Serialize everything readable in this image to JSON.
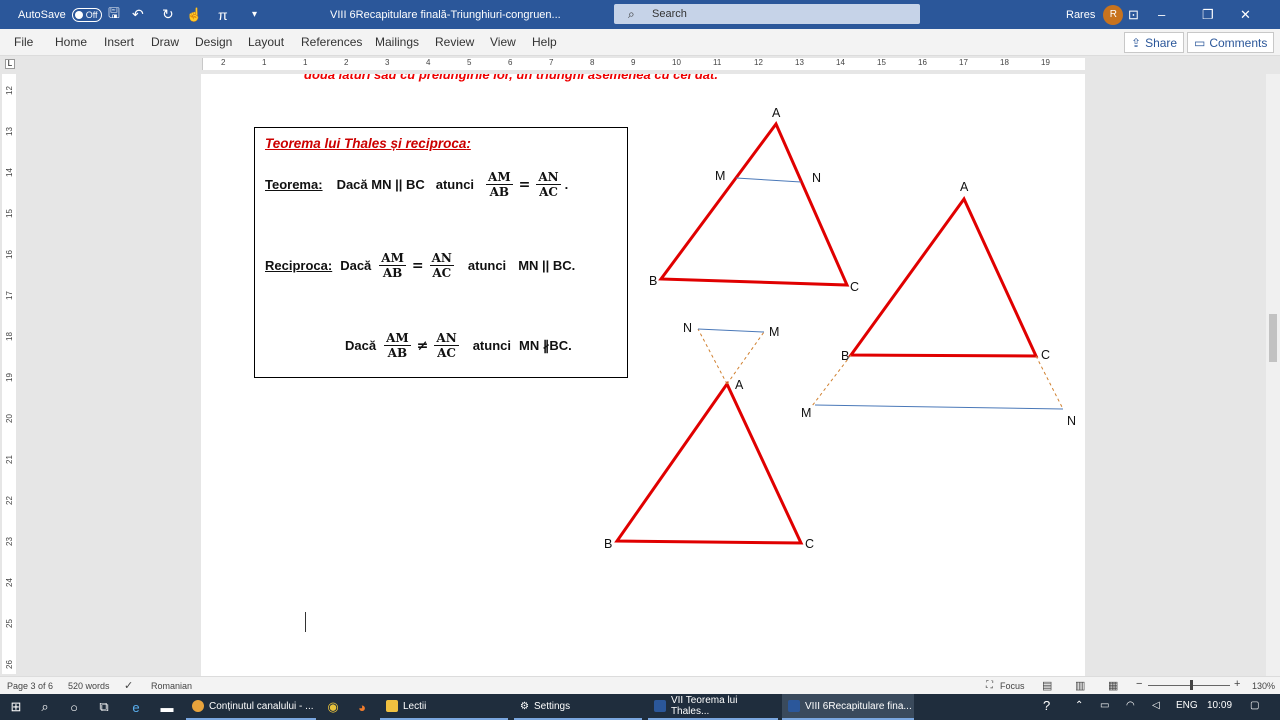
{
  "titlebar": {
    "autosave_label": "AutoSave",
    "autosave_state": "Off",
    "doc_title": "VIII 6Recapitulare finală-Triunghiuri-congruen...",
    "search_placeholder": "Search",
    "user_name": "Rares",
    "user_initial": "R"
  },
  "menu": {
    "items": [
      "File",
      "Home",
      "Insert",
      "Draw",
      "Design",
      "Layout",
      "References",
      "Mailings",
      "Review",
      "View",
      "Help"
    ],
    "share": "Share",
    "comments": "Comments"
  },
  "ruler": {
    "numbers": [
      "2",
      "1",
      "1",
      "2",
      "3",
      "4",
      "5",
      "6",
      "7",
      "8",
      "9",
      "10",
      "11",
      "12",
      "13",
      "14",
      "15",
      "16",
      "17",
      "18",
      "19"
    ],
    "vertical_numbers": [
      "12",
      "13",
      "14",
      "15",
      "16",
      "17",
      "18",
      "19",
      "20",
      "21",
      "22",
      "23",
      "24",
      "25",
      "26"
    ]
  },
  "document": {
    "cut_text": "două laturi sau cu prelungirile lor, un triunghi asemenea cu cel dat.",
    "box": {
      "title": "Teorema lui Thales și reciproca",
      "title_colon": ":",
      "theorem_label": "Teorema:",
      "theorem_condition": "Dacă MN || BC",
      "then": "atunci",
      "frac1_num": "AM",
      "frac1_den": "AB",
      "equals": "=",
      "frac2_num": "AN",
      "frac2_den": "AC",
      "end_dot": ".",
      "reciprocal_label": "Reciproca:",
      "if_word": "Dacă",
      "reciprocal_conclusion": "MN || BC.",
      "not_equal": "≠",
      "neg_conclusion": "MN ∦BC."
    },
    "figures": {
      "triangle1": {
        "A": "A",
        "B": "B",
        "C": "C",
        "M": "M",
        "N": "N"
      },
      "triangle2": {
        "A": "A",
        "B": "B",
        "C": "C",
        "M": "M",
        "N": "N"
      },
      "triangle3": {
        "A": "A",
        "B": "B",
        "C": "C",
        "M": "M",
        "N": "N"
      }
    },
    "colors": {
      "triangle": "#e00000",
      "parallel": "#4a78b8",
      "extension": "#d08030"
    }
  },
  "status": {
    "page": "Page 3 of 6",
    "words": "520 words",
    "language": "Romanian",
    "focus": "Focus",
    "zoom": "130%"
  },
  "taskbar": {
    "apps": [
      "Conținutul canalului - ...",
      "Lectii",
      "Settings",
      "VII Teorema lui Thales...",
      "VIII 6Recapitulare fina..."
    ],
    "lang": "ENG",
    "time": "10:09"
  }
}
